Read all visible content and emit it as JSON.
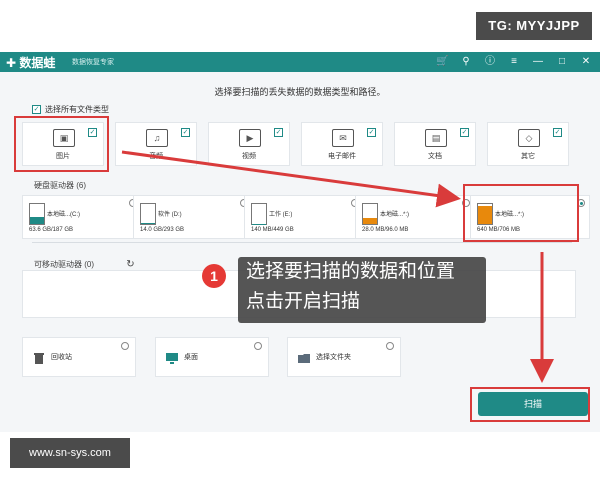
{
  "watermarks": {
    "top": "TG: MYYJJPP",
    "bottom": "www.sn-sys.com"
  },
  "app": {
    "logo": "数据蛙",
    "subtitle": "数据恢复专家",
    "toolbar_icons": [
      "cart-icon",
      "pin-icon",
      "info-icon",
      "menu-icon",
      "minimize-icon",
      "maximize-icon",
      "close-icon"
    ]
  },
  "instruction": "选择要扫描的丢失数据的数据类型和路径。",
  "select_all": "选择所有文件类型",
  "file_types": [
    {
      "label": "图片",
      "icon": "image-icon",
      "checked": true
    },
    {
      "label": "音频",
      "icon": "music-icon",
      "checked": true
    },
    {
      "label": "视频",
      "icon": "video-icon",
      "checked": true
    },
    {
      "label": "电子邮件",
      "icon": "email-icon",
      "checked": true
    },
    {
      "label": "文档",
      "icon": "document-icon",
      "checked": true
    },
    {
      "label": "其它",
      "icon": "other-icon",
      "checked": true
    }
  ],
  "disk_section": "硬盘驱动器 (6)",
  "drives": [
    {
      "name": "本地磁...(C:)",
      "size": "63.6 GB/187 GB",
      "fill": 0.34,
      "color": "#1f8a86",
      "selected": false
    },
    {
      "name": "软件 (D:)",
      "size": "14.0 GB/293 GB",
      "fill": 0.05,
      "color": "#1f8a86",
      "selected": false
    },
    {
      "name": "工作 (E:)",
      "size": "140 MB/449 GB",
      "fill": 0.01,
      "color": "#1f8a86",
      "selected": false
    },
    {
      "name": "本地磁...*:)",
      "size": "28.0 MB/96.0 MB",
      "fill": 0.29,
      "color": "#e8890c",
      "selected": false
    },
    {
      "name": "本地磁...*:)",
      "size": "640 MB/706 MB",
      "fill": 0.91,
      "color": "#e8890c",
      "selected": true
    }
  ],
  "removable_section": "可移动驱动器 (0)",
  "locations": [
    {
      "label": "回收站",
      "icon": "recycle-bin-icon"
    },
    {
      "label": "桌面",
      "icon": "desktop-icon"
    },
    {
      "label": "选择文件夹",
      "icon": "folder-icon"
    }
  ],
  "scan_button": "扫描",
  "callout": {
    "number": "1",
    "line1": "选择要扫描的数据和位置",
    "line2": "点击开启扫描"
  }
}
